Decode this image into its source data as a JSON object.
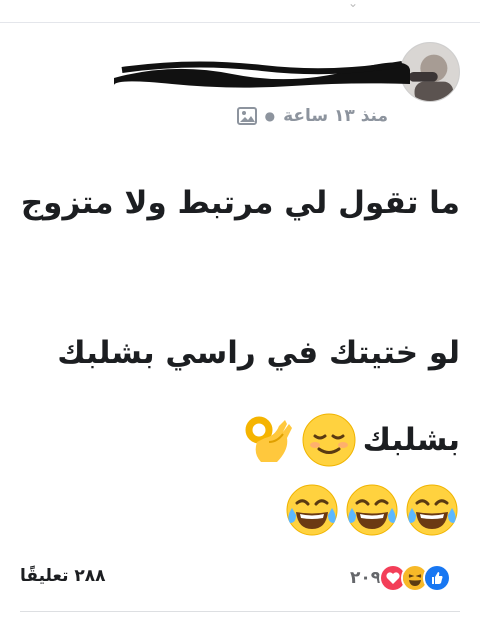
{
  "post": {
    "timestamp": "منذ ١٣ ساعة",
    "lines": {
      "line1": "ما تقول لي مرتبط ولا متزوج",
      "line2": "لو ختيتك في راسي بشلبك",
      "line3": "بشلبك"
    },
    "emojis_line3": [
      "relieved-face",
      "ok-hand"
    ],
    "emojis_line4": [
      "tears-of-joy",
      "tears-of-joy",
      "tears-of-joy"
    ]
  },
  "footer": {
    "reaction_count": "٢٠٩",
    "reaction_icons": [
      "like",
      "haha",
      "love"
    ],
    "comments": "٢٨٨ تعليقًا"
  },
  "colors": {
    "like": "#1877f2",
    "haha": "#f7b928",
    "love": "#f33e58",
    "meta": "#8d949e"
  }
}
